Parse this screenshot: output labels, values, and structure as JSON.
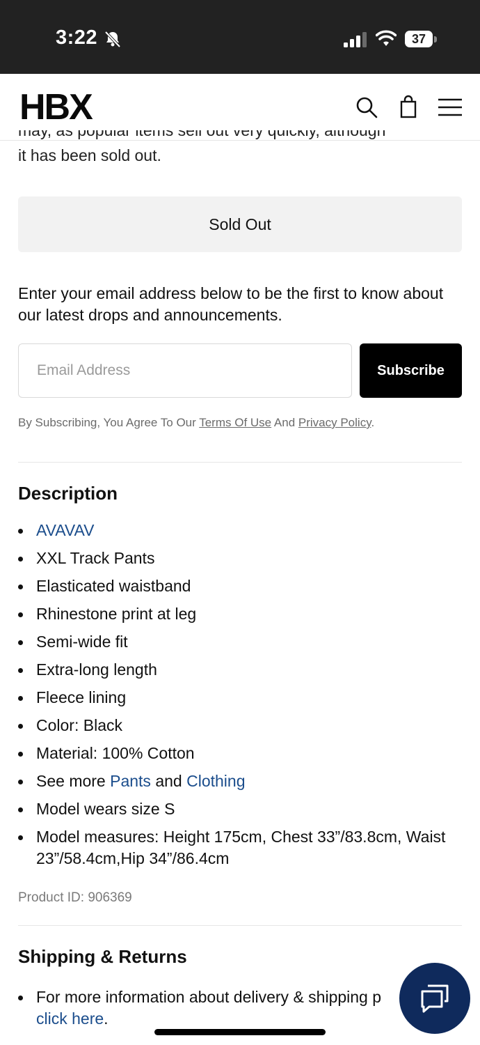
{
  "status_bar": {
    "time": "3:22",
    "battery": "37"
  },
  "header": {
    "logo": "HBX"
  },
  "clipped_text": "may, as popular items sell out very quickly, although",
  "sold_out_note": "it has been sold out.",
  "sold_out_button": "Sold Out",
  "newsletter": {
    "text": "Enter your email address below to be the first to know about our latest drops and announcements.",
    "email_placeholder": "Email Address",
    "subscribe_label": "Subscribe",
    "consent_prefix": "By Subscribing, You Agree To Our ",
    "terms_label": "Terms Of Use",
    "consent_and": " And ",
    "privacy_label": "Privacy Policy",
    "consent_suffix": "."
  },
  "description": {
    "title": "Description",
    "brand": "AVAVAV",
    "items": [
      "XXL Track Pants",
      "Elasticated waistband",
      "Rhinestone print at leg",
      "Semi-wide fit",
      "Extra-long length",
      "Fleece lining",
      "Color: Black",
      "Material: 100% Cotton"
    ],
    "see_more_prefix": "See more ",
    "see_more_link1": "Pants",
    "see_more_and": " and ",
    "see_more_link2": "Clothing",
    "model_size": "Model wears size S",
    "model_measures": "Model measures: Height 175cm, Chest 33”/83.8cm, Waist 23”/58.4cm,Hip 34”/86.4cm"
  },
  "product_id": "Product ID: 906369",
  "shipping": {
    "title": "Shipping & Returns",
    "text": "For more information about delivery & shipping p",
    "link": "click here",
    "link_suffix": "."
  },
  "colors": {
    "link": "#1b4d8c",
    "chat_bg": "#0f2a5c",
    "status_bar": "#222222"
  },
  "icons": [
    "bell-slash-icon",
    "signal-icon",
    "wifi-icon",
    "battery-icon",
    "search-icon",
    "shopping-bag-icon",
    "hamburger-menu-icon",
    "chat-icon"
  ]
}
